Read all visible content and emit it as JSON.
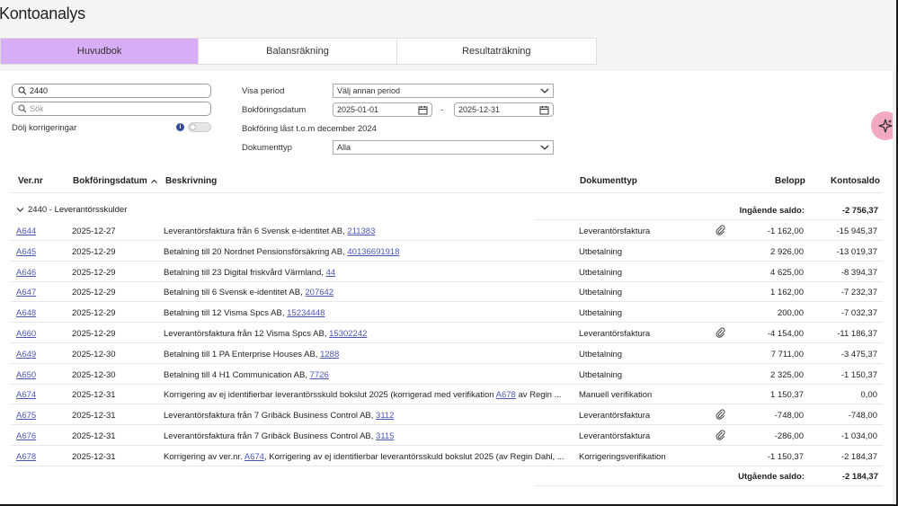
{
  "page": {
    "title": "Kontoanalys"
  },
  "tabs": [
    "Huvudbok",
    "Balansräkning",
    "Resultaträkning"
  ],
  "filters": {
    "account_search_value": "2440",
    "search_placeholder": "Sök",
    "hide_corrections_label": "Dölj korrigeringar",
    "period_label": "Visa period",
    "period_value": "Välj annan period",
    "date_label": "Bokföringsdatum",
    "date_from": "2025-01-01",
    "date_separator": "-",
    "date_to": "2025-12-31",
    "locked_text": "Bokföring låst t.o.m december 2024",
    "doctype_label": "Dokumenttyp",
    "doctype_value": "Alla"
  },
  "table": {
    "headers": {
      "ver": "Ver.nr",
      "date": "Bokföringsdatum",
      "desc": "Beskrivning",
      "type": "Dokumenttyp",
      "amount": "Belopp",
      "balance": "Kontosaldo"
    },
    "group_label": "2440 - Leverantörsskulder",
    "opening_label": "Ingående saldo:",
    "opening_value": "-2 756,37",
    "closing_label": "Utgående saldo:",
    "closing_value": "-2 184,37",
    "rows": [
      {
        "ver": "A644",
        "date": "2025-12-27",
        "desc": "Leverantörsfaktura från 6 Svensk e-identitet AB, ",
        "link": "211383",
        "desc_tail": "",
        "type": "Leverantörsfaktura",
        "attachment": true,
        "amount": "-1 162,00",
        "balance": "-15 945,37"
      },
      {
        "ver": "A645",
        "date": "2025-12-29",
        "desc": "Betalning till 20 Nordnet Pensionsförsäkring AB, ",
        "link": "40136691918",
        "desc_tail": "",
        "type": "Utbetalning",
        "attachment": false,
        "amount": "2 926,00",
        "balance": "-13 019,37"
      },
      {
        "ver": "A646",
        "date": "2025-12-29",
        "desc": "Betalning till 23 Digital friskvård Värmland, ",
        "link": "44",
        "desc_tail": "",
        "type": "Utbetalning",
        "attachment": false,
        "amount": "4 625,00",
        "balance": "-8 394,37"
      },
      {
        "ver": "A647",
        "date": "2025-12-29",
        "desc": "Betalning till 6 Svensk e-identitet AB, ",
        "link": "207642",
        "desc_tail": "",
        "type": "Utbetalning",
        "attachment": false,
        "amount": "1 162,00",
        "balance": "-7 232,37"
      },
      {
        "ver": "A648",
        "date": "2025-12-29",
        "desc": "Betalning till 12 Visma Spcs AB, ",
        "link": "15234448",
        "desc_tail": "",
        "type": "Utbetalning",
        "attachment": false,
        "amount": "200,00",
        "balance": "-7 032,37"
      },
      {
        "ver": "A660",
        "date": "2025-12-29",
        "desc": "Leverantörsfaktura från 12 Visma Spcs AB, ",
        "link": "15302242",
        "desc_tail": "",
        "type": "Leverantörsfaktura",
        "attachment": true,
        "amount": "-4 154,00",
        "balance": "-11 186,37"
      },
      {
        "ver": "A649",
        "date": "2025-12-30",
        "desc": "Betalning till 1 PA Enterprise Houses AB, ",
        "link": "1288",
        "desc_tail": "",
        "type": "Utbetalning",
        "attachment": false,
        "amount": "7 711,00",
        "balance": "-3 475,37"
      },
      {
        "ver": "A650",
        "date": "2025-12-30",
        "desc": "Betalning till 4 H1 Communication AB, ",
        "link": "7726",
        "desc_tail": "",
        "type": "Utbetalning",
        "attachment": false,
        "amount": "2 325,00",
        "balance": "-1 150,37"
      },
      {
        "ver": "A674",
        "date": "2025-12-31",
        "desc": "Korrigering av ej identifierbar leverantörsskuld bokslut 2025 (korrigerad med verifikation ",
        "link": "A678",
        "desc_tail": " av Regin ...",
        "type": "Manuell verifikation",
        "attachment": false,
        "amount": "1 150,37",
        "balance": "0,00"
      },
      {
        "ver": "A675",
        "date": "2025-12-31",
        "desc": "Leverantörsfaktura från 7 Gribäck Business Control AB, ",
        "link": "3112",
        "desc_tail": "",
        "type": "Leverantörsfaktura",
        "attachment": true,
        "amount": "-748,00",
        "balance": "-748,00"
      },
      {
        "ver": "A676",
        "date": "2025-12-31",
        "desc": "Leverantörsfaktura från 7 Gribäck Business Control AB, ",
        "link": "3115",
        "desc_tail": "",
        "type": "Leverantörsfaktura",
        "attachment": true,
        "amount": "-286,00",
        "balance": "-1 034,00"
      },
      {
        "ver": "A678",
        "date": "2025-12-31",
        "desc": "Korrigering av ver.nr. ",
        "link": "A674",
        "desc_tail": ", Korrigering av ej identifierbar leverantörsskuld bokslut 2025 (av Regin Dahl, ...",
        "type": "Korrigeringsverifikation",
        "attachment": false,
        "amount": "-1 150,37",
        "balance": "-2 184,37"
      }
    ]
  },
  "icons": {
    "search": "search-icon",
    "calendar": "calendar-icon",
    "chevron": "chevron-down-icon",
    "attachment": "paperclip-icon",
    "ai": "sparkle-icon"
  },
  "colors": {
    "active_tab": "#d7aef6",
    "link": "#4a56b8",
    "ai_button": "#f3a9bf"
  }
}
